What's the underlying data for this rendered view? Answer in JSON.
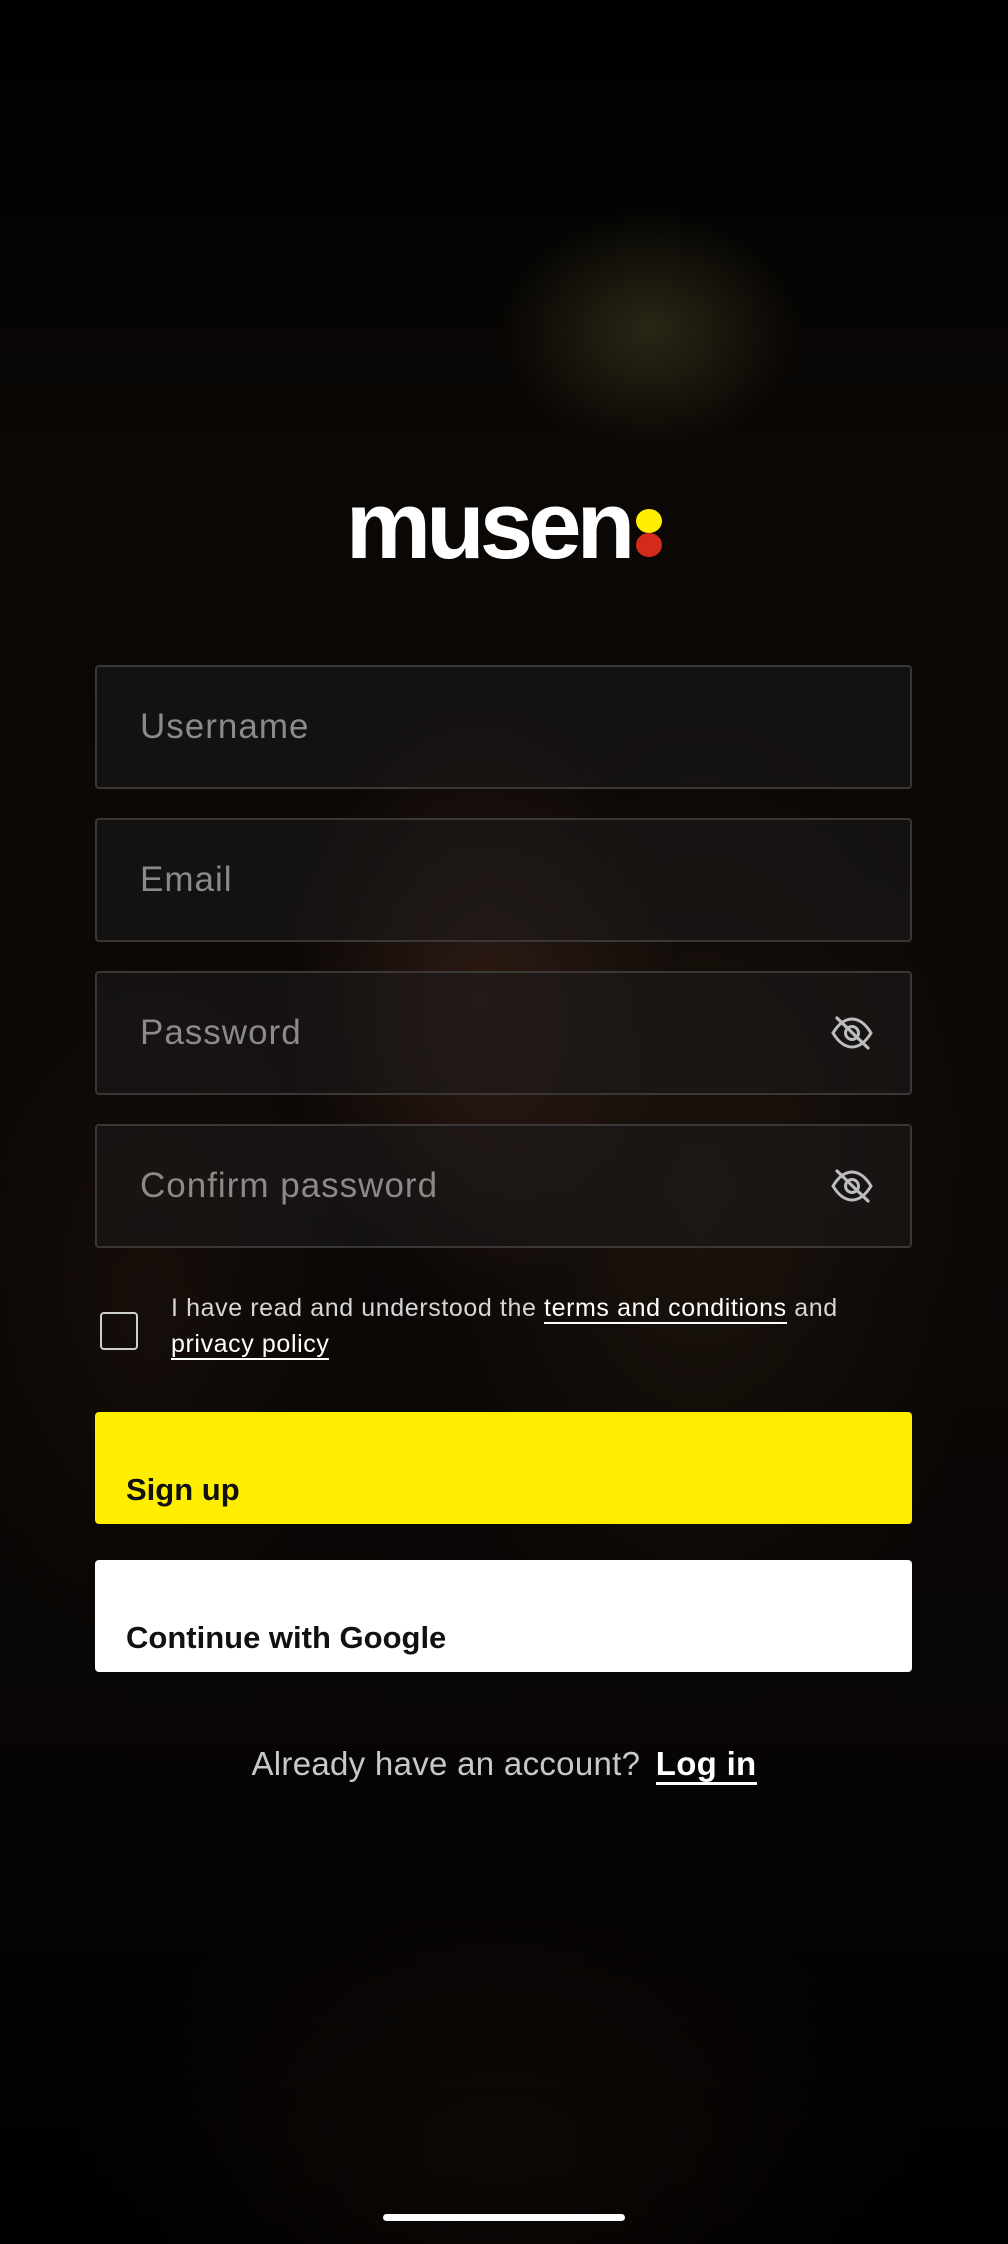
{
  "app": {
    "logo_text": "musen",
    "logo_dot_colors": [
      "#ffee00",
      "#d42a1e"
    ]
  },
  "form": {
    "username_placeholder": "Username",
    "email_placeholder": "Email",
    "password_placeholder": "Password",
    "confirm_password_placeholder": "Confirm password",
    "password_toggle_icon": "eye-off-icon"
  },
  "terms": {
    "prefix": "I have read and understood the ",
    "terms_link": "terms and conditions",
    "middle": " and",
    "privacy_link": "privacy policy",
    "checked": false
  },
  "buttons": {
    "signup_label": "Sign up",
    "google_label": "Continue with Google"
  },
  "login": {
    "prompt": "Already have an account?",
    "link_label": "Log in"
  },
  "colors": {
    "accent": "#ffee00",
    "secondary_button": "#ffffff",
    "background": "#000000"
  }
}
